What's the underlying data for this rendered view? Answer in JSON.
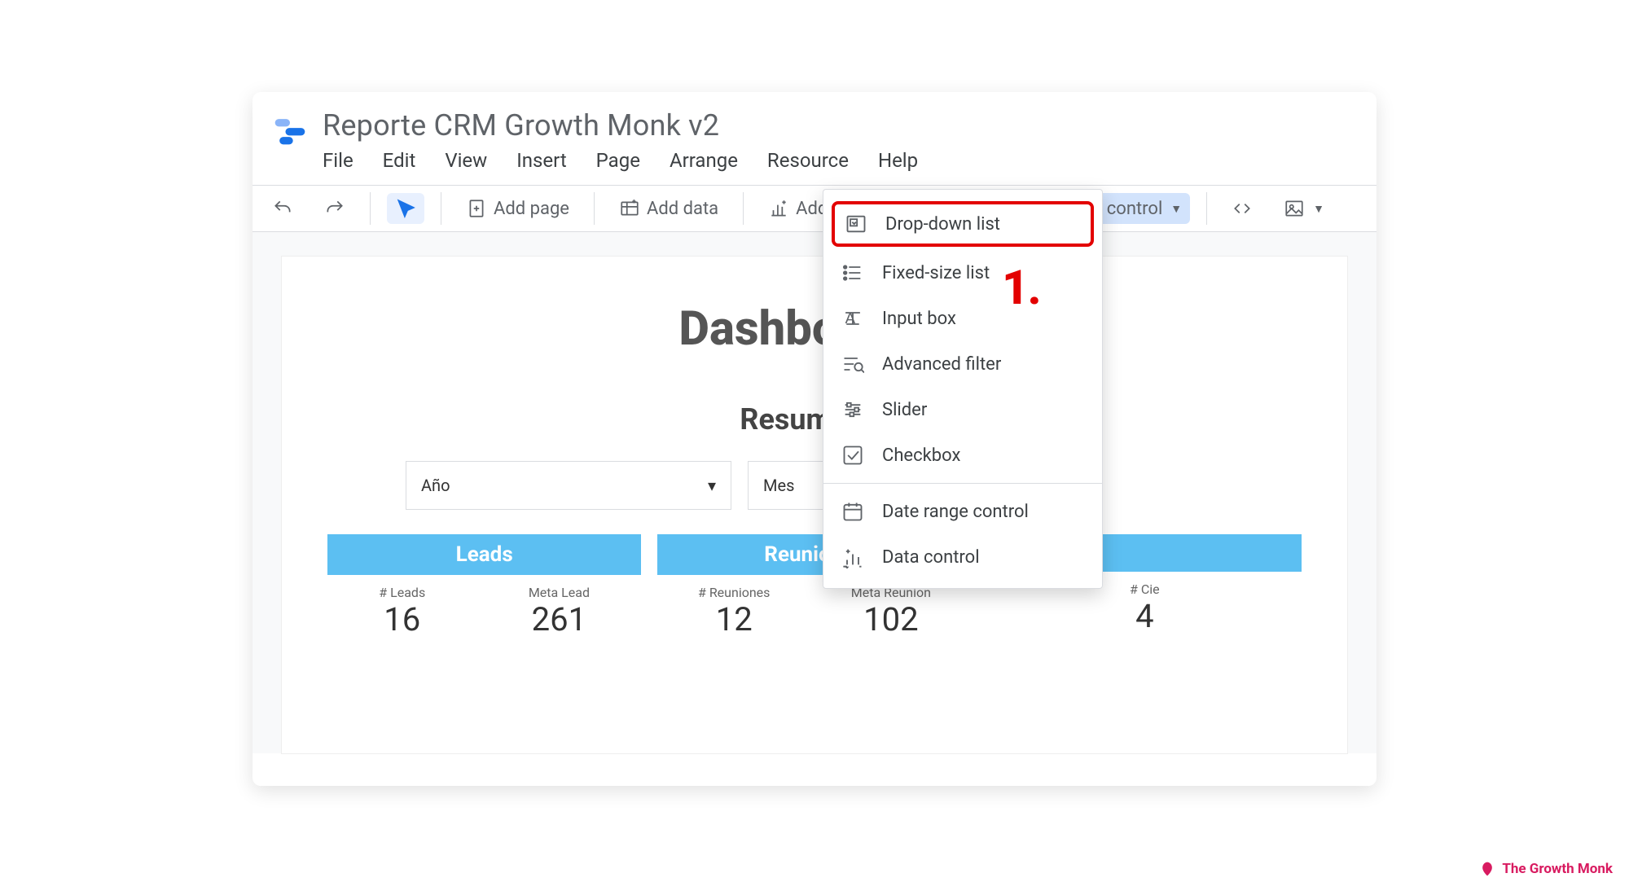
{
  "doc_title": "Reporte CRM Growth Monk v2",
  "menubar": [
    "File",
    "Edit",
    "View",
    "Insert",
    "Page",
    "Arrange",
    "Resource",
    "Help"
  ],
  "toolbar": {
    "add_page": "Add page",
    "add_data": "Add data",
    "add_chart": "Add a chart",
    "add_control": "Add a control"
  },
  "canvas": {
    "title": "Dashboard C",
    "section": "Resumen Y",
    "filters": [
      {
        "label": "Año"
      },
      {
        "label": "Mes"
      }
    ],
    "cards": [
      {
        "title": "Leads",
        "metrics": [
          {
            "label": "# Leads",
            "value": "16"
          },
          {
            "label": "Meta Lead",
            "value": "261"
          }
        ]
      },
      {
        "title": "Reuniones",
        "metrics": [
          {
            "label": "# Reuniones",
            "value": "12"
          },
          {
            "label": "Meta Reunion",
            "value": "102"
          }
        ]
      },
      {
        "title": "",
        "metrics": [
          {
            "label": "# Cie",
            "value": "4"
          }
        ]
      }
    ]
  },
  "control_menu": {
    "groups": [
      [
        {
          "icon": "dropdown",
          "label": "Drop-down list",
          "highlight": true
        },
        {
          "icon": "list",
          "label": "Fixed-size list"
        },
        {
          "icon": "inputbox",
          "label": "Input box"
        },
        {
          "icon": "advfilter",
          "label": "Advanced filter"
        },
        {
          "icon": "slider",
          "label": "Slider"
        },
        {
          "icon": "checkbox",
          "label": "Checkbox"
        }
      ],
      [
        {
          "icon": "daterange",
          "label": "Date range control"
        },
        {
          "icon": "datacontrol",
          "label": "Data control"
        }
      ]
    ]
  },
  "annotation": {
    "marker": "1."
  },
  "footer": {
    "brand": "The Growth Monk"
  }
}
